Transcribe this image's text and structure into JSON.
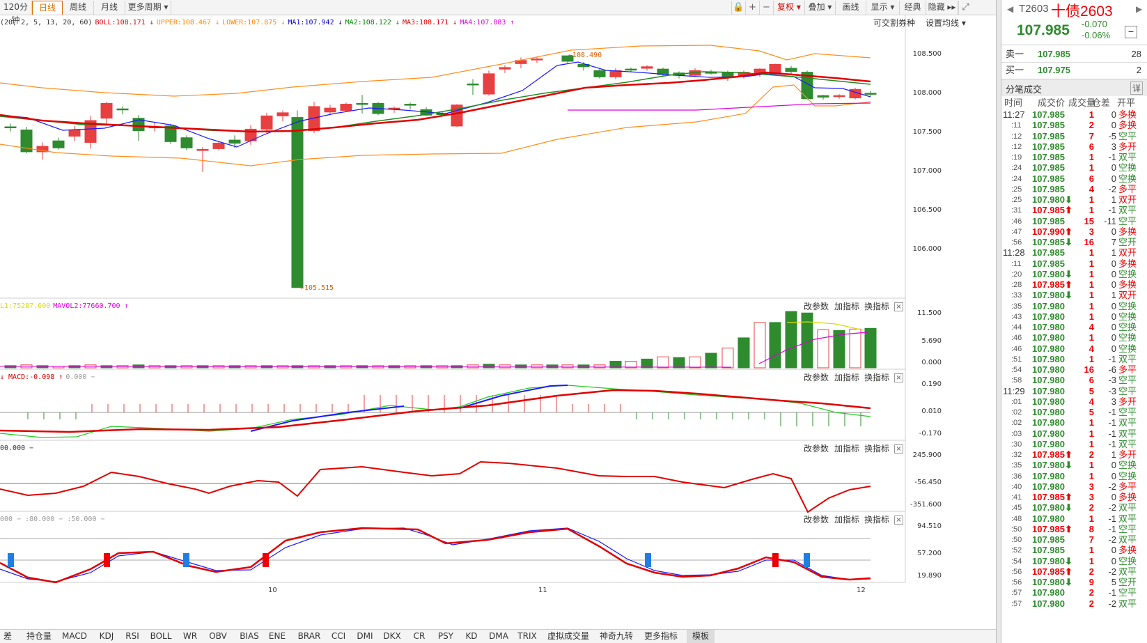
{
  "toolbar": {
    "periods": [
      "120分钟",
      "日线",
      "周线",
      "月线",
      "更多周期 ▾"
    ],
    "active_period": "日线",
    "right_buttons": [
      "复权 ▾",
      "叠加 ▾",
      "画线",
      "显示 ▾",
      "经典",
      "隐藏 ▸▸"
    ],
    "icons": [
      "lock-icon",
      "zoom-in-icon",
      "zoom-out-icon",
      "fullscreen-icon"
    ]
  },
  "main_panel": {
    "indicator_prefix": "(20, 2, 5, 13, 20, 60)",
    "legend": [
      {
        "text": "BOLL:108.171 ↓",
        "color": "#dd0000"
      },
      {
        "text": "UPPER:108.467 ↓",
        "color": "#ff8800"
      },
      {
        "text": "LOWER:107.875 ↓",
        "color": "#ff8800"
      },
      {
        "text": "MA1:107.942 ↓",
        "color": "#0000cc"
      },
      {
        "text": "MA2:108.122 ↓",
        "color": "#008800"
      },
      {
        "text": "MA3:108.171 ↓",
        "color": "#dd0000"
      },
      {
        "text": "MA4:107.883 ↑",
        "color": "#dd00dd"
      }
    ],
    "buttons": [
      "可交割券种",
      "设置均线 ▾"
    ],
    "y_ticks": [
      "108.500",
      "108.000",
      "107.500",
      "107.000",
      "106.500",
      "106.000"
    ],
    "high_label": "←108.490",
    "low_label": "←105.515"
  },
  "vol_panel": {
    "legend": [
      {
        "text": "L1:75287.600",
        "color": "#dddd00"
      },
      {
        "text": "MAVOL2:77660.700 ↑",
        "color": "#dd00dd"
      }
    ],
    "y_ticks": [
      "11.500",
      "5.690",
      "0.000"
    ]
  },
  "macd_panel": {
    "legend": [
      {
        "text": "↓ MACD:-0.098 ↑",
        "color": "#dd0000"
      },
      {
        "text": "0.000 −",
        "color": "#999999"
      }
    ],
    "y_ticks": [
      "0.190",
      "0.010",
      "-0.170"
    ]
  },
  "ind3_panel": {
    "legend": [
      {
        "text": "00.000 −",
        "color": "#333333"
      }
    ],
    "y_ticks": [
      "245.900",
      "-56.450",
      "-351.600"
    ]
  },
  "kdj_panel": {
    "legend": [
      {
        "text": "000 − :80.000 − :50.000 −",
        "color": "#999999"
      }
    ],
    "y_ticks": [
      "94.510",
      "57.200",
      "19.890"
    ]
  },
  "panel_buttons": [
    "改参数",
    "加指标",
    "换指标"
  ],
  "x_ticks": [
    "10",
    "11",
    "12"
  ],
  "bottom_tabs": [
    "差",
    "持仓量",
    "MACD",
    "KDJ",
    "RSI",
    "BOLL",
    "WR",
    "OBV",
    "BIAS",
    "ENE",
    "BRAR",
    "CCI",
    "DMI",
    "DKX",
    "CR",
    "PSY",
    "KD",
    "DMA",
    "TRIX",
    "虚拟成交量",
    "神奇九转",
    "更多指标",
    "模板"
  ],
  "active_tab": "模板",
  "quote": {
    "code": "T2603",
    "name": "十债2603",
    "price": "107.985",
    "change": "-0.070",
    "change_pct": "-0.06%",
    "sell_label": "卖一",
    "sell_price": "107.985",
    "sell_vol": "28",
    "buy_label": "买一",
    "buy_price": "107.975",
    "buy_vol": "2",
    "ticks_title": "分笔成交",
    "detail_btn": "详",
    "cols": [
      "时间",
      "成交价",
      "成交量",
      "仓差",
      "开平"
    ]
  },
  "ticks": [
    [
      "11:27",
      "107.985",
      "",
      "1",
      "0",
      "多换"
    ],
    [
      ":11",
      "107.985",
      "",
      "2",
      "0",
      "多换"
    ],
    [
      ":12",
      "107.985",
      "",
      "7",
      "-5",
      "空平"
    ],
    [
      ":12",
      "107.985",
      "",
      "6",
      "3",
      "多开"
    ],
    [
      ":19",
      "107.985",
      "",
      "1",
      "-1",
      "双平"
    ],
    [
      ":24",
      "107.985",
      "",
      "1",
      "0",
      "空换"
    ],
    [
      ":24",
      "107.985",
      "",
      "6",
      "0",
      "空换"
    ],
    [
      ":25",
      "107.985",
      "",
      "4",
      "-2",
      "多平"
    ],
    [
      ":25",
      "107.980",
      "down",
      "1",
      "1",
      "双开"
    ],
    [
      ":31",
      "107.985",
      "up",
      "1",
      "-1",
      "双平"
    ],
    [
      ":46",
      "107.985",
      "",
      "15",
      "-11",
      "空平"
    ],
    [
      ":47",
      "107.990",
      "up",
      "3",
      "0",
      "多换"
    ],
    [
      ":56",
      "107.985",
      "down",
      "16",
      "7",
      "空开"
    ],
    [
      "11:28",
      "107.985",
      "",
      "1",
      "1",
      "双开"
    ],
    [
      ":11",
      "107.985",
      "",
      "1",
      "0",
      "多换"
    ],
    [
      ":20",
      "107.980",
      "down",
      "1",
      "0",
      "空换"
    ],
    [
      ":28",
      "107.985",
      "up",
      "1",
      "0",
      "多换"
    ],
    [
      ":33",
      "107.980",
      "down",
      "1",
      "1",
      "双开"
    ],
    [
      ":35",
      "107.980",
      "",
      "1",
      "0",
      "空换"
    ],
    [
      ":43",
      "107.980",
      "",
      "1",
      "0",
      "空换"
    ],
    [
      ":44",
      "107.980",
      "",
      "4",
      "0",
      "空换"
    ],
    [
      ":46",
      "107.980",
      "",
      "1",
      "0",
      "空换"
    ],
    [
      ":46",
      "107.980",
      "",
      "4",
      "0",
      "空换"
    ],
    [
      ":51",
      "107.980",
      "",
      "1",
      "-1",
      "双平"
    ],
    [
      ":54",
      "107.980",
      "",
      "16",
      "-6",
      "多平"
    ],
    [
      ":58",
      "107.980",
      "",
      "6",
      "-3",
      "空平"
    ],
    [
      "11:29",
      "107.980",
      "",
      "5",
      "-3",
      "空平"
    ],
    [
      ":01",
      "107.980",
      "",
      "4",
      "3",
      "多开"
    ],
    [
      ":02",
      "107.980",
      "",
      "5",
      "-1",
      "空平"
    ],
    [
      ":02",
      "107.980",
      "",
      "1",
      "-1",
      "双平"
    ],
    [
      ":03",
      "107.980",
      "",
      "1",
      "-1",
      "双平"
    ],
    [
      ":30",
      "107.980",
      "",
      "1",
      "-1",
      "双平"
    ],
    [
      ":32",
      "107.985",
      "up",
      "2",
      "1",
      "多开"
    ],
    [
      ":35",
      "107.980",
      "down",
      "1",
      "0",
      "空换"
    ],
    [
      ":36",
      "107.980",
      "",
      "1",
      "0",
      "空换"
    ],
    [
      ":40",
      "107.980",
      "",
      "3",
      "-2",
      "多平"
    ],
    [
      ":41",
      "107.985",
      "up",
      "3",
      "0",
      "多换"
    ],
    [
      ":45",
      "107.980",
      "down",
      "2",
      "-2",
      "双平"
    ],
    [
      ":48",
      "107.980",
      "",
      "1",
      "-1",
      "双平"
    ],
    [
      ":50",
      "107.985",
      "up",
      "8",
      "-1",
      "空平"
    ],
    [
      ":50",
      "107.985",
      "",
      "7",
      "-2",
      "双平"
    ],
    [
      ":52",
      "107.985",
      "",
      "1",
      "0",
      "多换"
    ],
    [
      ":54",
      "107.980",
      "down",
      "1",
      "0",
      "空换"
    ],
    [
      ":56",
      "107.985",
      "up",
      "2",
      "-2",
      "双平"
    ],
    [
      ":56",
      "107.980",
      "down",
      "9",
      "5",
      "空开"
    ],
    [
      ":57",
      "107.980",
      "",
      "2",
      "-1",
      "空平"
    ],
    [
      ":57",
      "107.980",
      "",
      "2",
      "-2",
      "双平"
    ]
  ],
  "colors": {
    "up": "#e84040",
    "down": "#2e8b2e",
    "boll_mid": "#e00000",
    "boll_band": "#ff8c1a",
    "ma1": "#1a1aff",
    "ma2": "#228b22",
    "ma3": "#e00000",
    "ma4": "#dd00dd"
  }
}
